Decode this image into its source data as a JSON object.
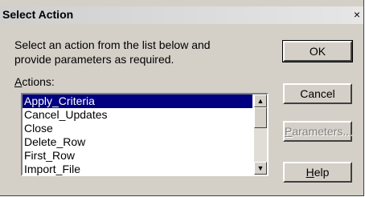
{
  "dialog": {
    "title": "Select Action",
    "close_glyph": "×",
    "instructions_line1": "Select an action from the list below and",
    "instructions_line2": "provide parameters as required.",
    "actions_label_first": "A",
    "actions_label_rest": "ctions:",
    "actions": [
      "Apply_Criteria",
      "Cancel_Updates",
      "Close",
      "Delete_Row",
      "First_Row",
      "Import_File"
    ],
    "selected_action": "Apply_Criteria",
    "buttons": {
      "ok": "OK",
      "cancel": "Cancel",
      "parameters_first": "P",
      "parameters_rest": "arameters...",
      "help_first": "H",
      "help_rest": "elp"
    },
    "scroll_up_glyph": "▲",
    "scroll_down_glyph": "▼"
  }
}
